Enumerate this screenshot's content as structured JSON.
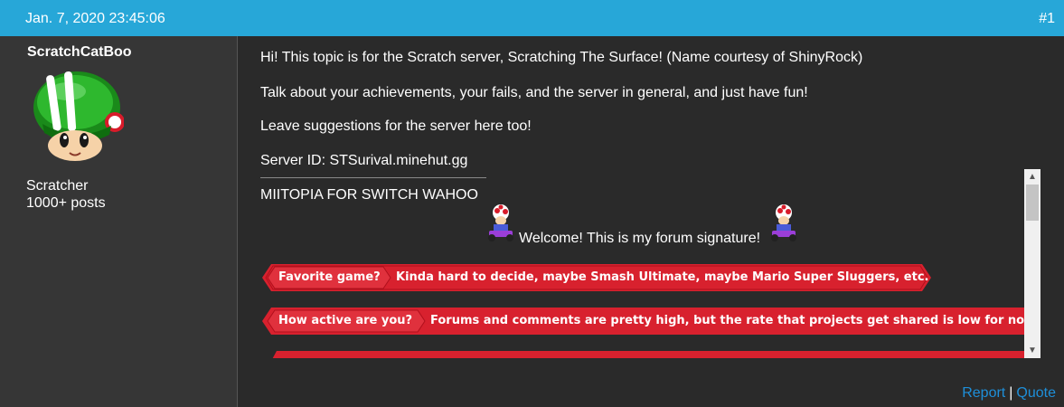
{
  "header": {
    "date": "Jan. 7, 2020 23:45:06",
    "post_number": "#1"
  },
  "author": {
    "username": "ScratchCatBoo",
    "rank": "Scratcher",
    "post_count": "1000+ posts",
    "avatar_icon": "green-toad-helmet-avatar"
  },
  "post": {
    "paragraphs": [
      "Hi! This topic is for the Scratch server, Scratching The Surface! (Name courtesy of ShinyRock)",
      "Talk about your achievements, your fails, and the server in general, and just have fun!",
      "Leave suggestions for the server here too!",
      "Server ID: STSurival.minehut.gg"
    ],
    "signature": {
      "first_line": "MIITOPIA FOR SWITCH WAHOO",
      "welcome": "Welcome! This is my forum signature!",
      "banners": [
        {
          "label": "Favorite game?",
          "text": "Kinda hard to decide, maybe Smash Ultimate, maybe Mario Super Sluggers, etc."
        },
        {
          "label": "How active are you?",
          "text": "Forums and comments are pretty high, but the rate that projects get shared is low for now"
        }
      ]
    }
  },
  "footer": {
    "report": "Report",
    "separator": "|",
    "quote": "Quote"
  },
  "colors": {
    "header": "#27a7d8",
    "sidebar": "#363636",
    "content": "#2a2a2a",
    "banner_red": "#d8212e",
    "link": "#1e8fd9"
  }
}
